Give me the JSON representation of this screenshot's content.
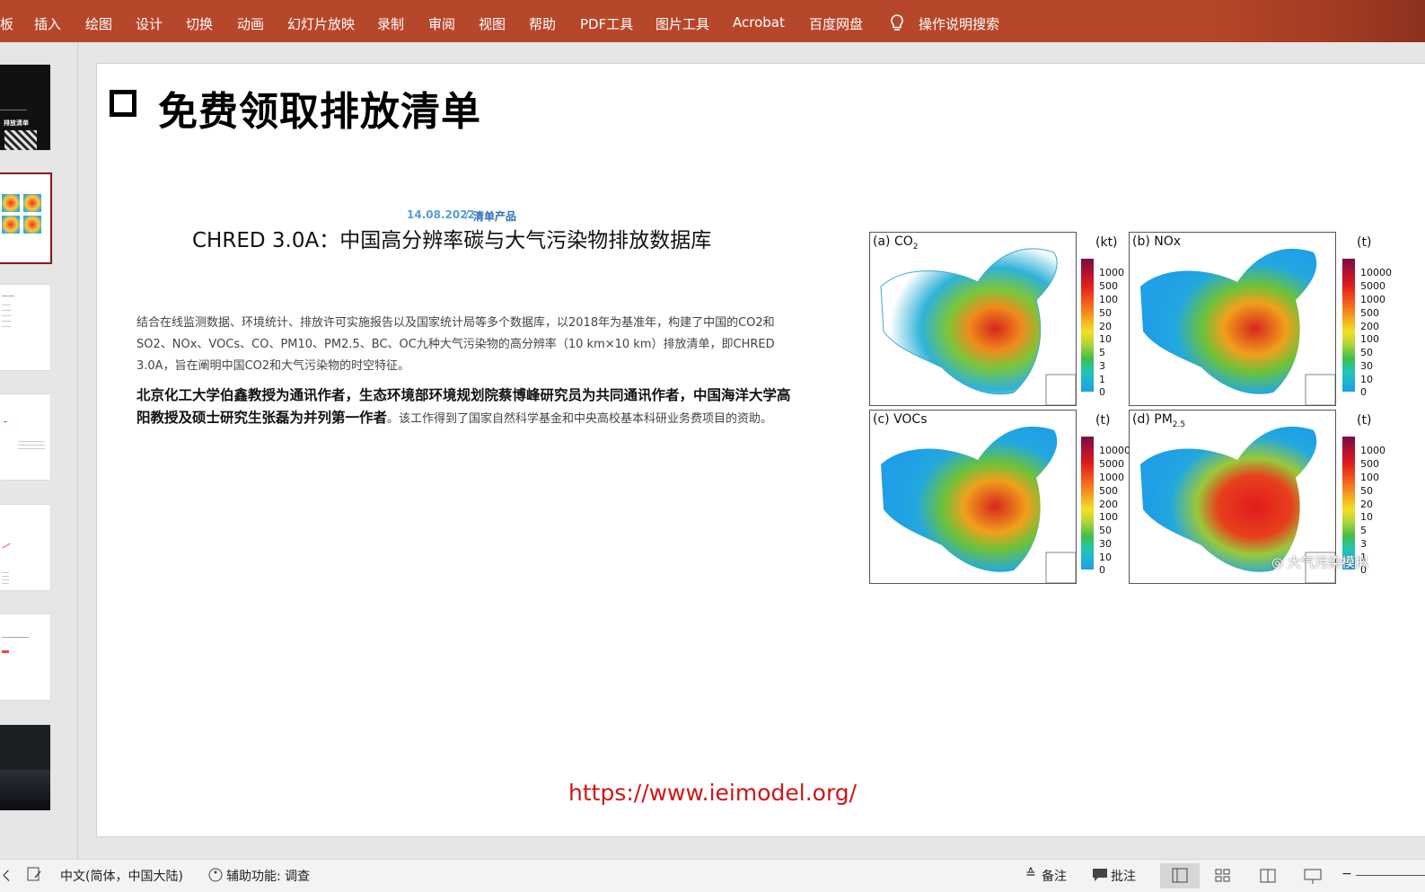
{
  "ribbon": {
    "tabs": [
      "板",
      "插入",
      "绘图",
      "设计",
      "切换",
      "动画",
      "幻灯片放映",
      "录制",
      "审阅",
      "视图",
      "帮助",
      "PDF工具",
      "图片工具",
      "Acrobat",
      "百度网盘"
    ],
    "search_label": "操作说明搜索",
    "accent": "#b7472a"
  },
  "thumbnails": {
    "selected_index": 1,
    "thumb0_text": "排放清单"
  },
  "slide": {
    "title": "免费领取排放清单",
    "meta_date": "14.08.2022",
    "meta_sep": "/",
    "meta_category": "清单产品",
    "article_title": "CHRED 3.0A：中国高分辨率碳与大气污染物排放数据库",
    "para1": "结合在线监测数据、环境统计、排放许可实施报告以及国家统计局等多个数据库，以2018年为基准年，构建了中国的CO2和SO2、NOx、VOCs、CO、PM10、PM2.5、BC、OC九种大气污染物的高分辨率（10 km×10 km）排放清单，即CHRED 3.0A，旨在阐明中国CO2和大气污染物的时空特征。",
    "para2_bold": "北京化工大学伯鑫教授为通讯作者，生态环境部环境规划院蔡博峰研究员为共同通讯作者，中国海洋大学高阳教授及硕士研究生张磊为并列第一作者",
    "para2_rest": "。该工作得到了国家自然科学基金和中央高校基本科研业务费项目的资助。",
    "url": "https://www.ieimodel.org/"
  },
  "figure": {
    "panels": [
      {
        "label": "(a) CO",
        "sub": "2",
        "unit": "(kt)",
        "ticks": [
          "1000",
          "500",
          "100",
          "50",
          "20",
          "10",
          "5",
          "3",
          "1",
          "0"
        ]
      },
      {
        "label": "(b) NOx",
        "sub": "",
        "unit": "(t)",
        "ticks": [
          "10000",
          "5000",
          "1000",
          "500",
          "200",
          "100",
          "50",
          "30",
          "10",
          "0"
        ]
      },
      {
        "label": "(c) VOCs",
        "sub": "",
        "unit": "(t)",
        "ticks": [
          "10000",
          "5000",
          "1000",
          "500",
          "200",
          "100",
          "50",
          "30",
          "10",
          "0"
        ]
      },
      {
        "label": "(d) PM",
        "sub": "2.5",
        "unit": "(t)",
        "ticks": [
          "1000",
          "500",
          "100",
          "50",
          "20",
          "10",
          "5",
          "3",
          "1",
          "0"
        ]
      }
    ],
    "watermark": "大气污染模拟"
  },
  "status": {
    "language": "中文(简体，中国大陆)",
    "accessibility": "辅助功能: 调查",
    "notes": "备注",
    "comments": "批注"
  }
}
